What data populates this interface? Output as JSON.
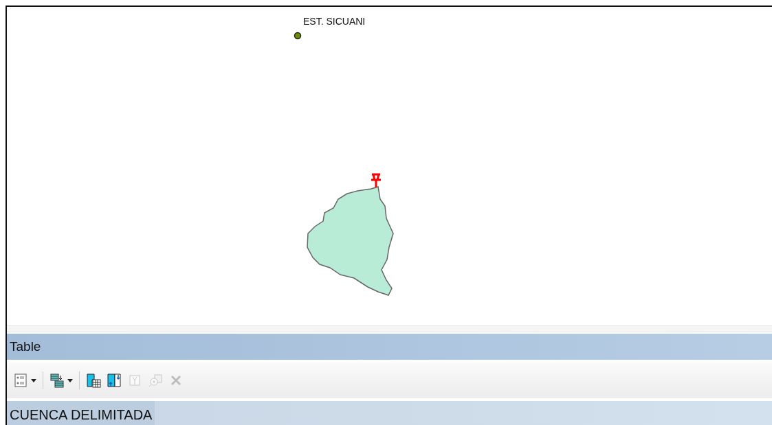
{
  "map": {
    "station": {
      "label": "EST. SICUANI"
    }
  },
  "table": {
    "title": "Table",
    "toolbar": [
      {
        "kind": "options",
        "disabled": false,
        "has_menu": true,
        "separator_after": true
      },
      {
        "kind": "related",
        "disabled": false,
        "has_menu": true,
        "separator_after": true
      },
      {
        "kind": "select",
        "disabled": false,
        "has_menu": false,
        "separator_after": false
      },
      {
        "kind": "switch",
        "disabled": false,
        "has_menu": false,
        "separator_after": false
      },
      {
        "kind": "clear",
        "disabled": true,
        "has_menu": false,
        "separator_after": false
      },
      {
        "kind": "zoom",
        "disabled": true,
        "has_menu": false,
        "separator_after": false
      },
      {
        "kind": "delete",
        "disabled": true,
        "has_menu": false,
        "separator_after": false
      }
    ],
    "tabs": [
      {
        "label": "CUENCA DELIMITADA",
        "selected": true
      }
    ]
  }
}
